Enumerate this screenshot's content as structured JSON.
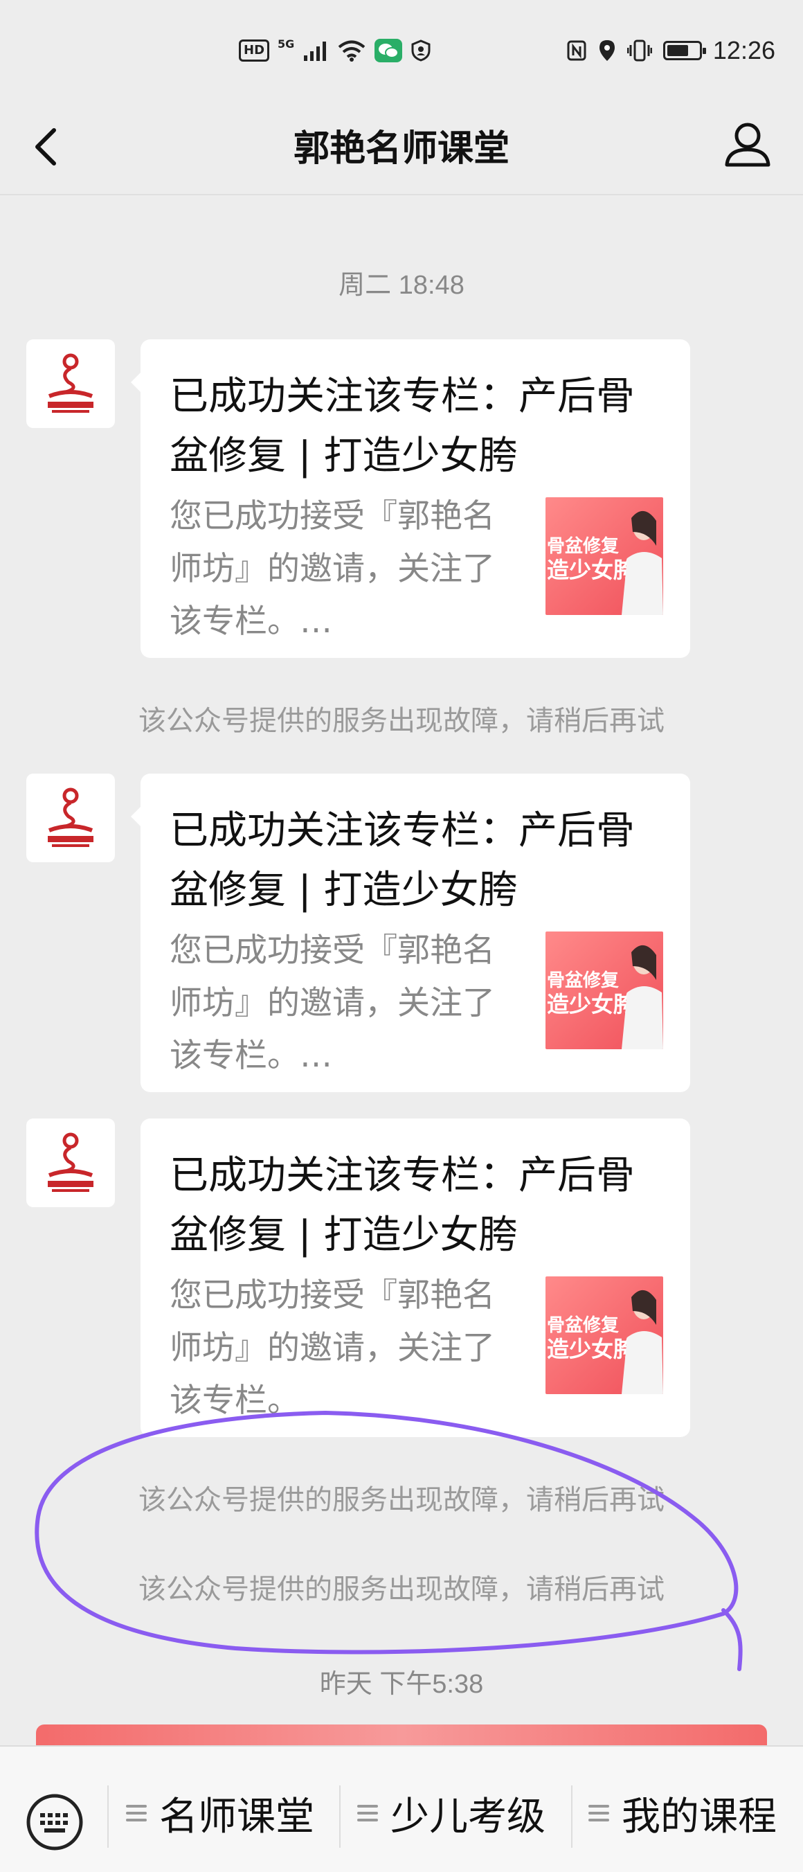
{
  "status_bar": {
    "hd_badge": "HD",
    "network": "5G",
    "time": "12:26"
  },
  "nav": {
    "title": "郭艳名师课堂"
  },
  "messages": {
    "timestamp_1": "周二 18:48",
    "card_1": {
      "title": "已成功关注该专栏：产后骨盆修复 | 打造少女胯",
      "desc": "您已成功接受『郭艳名师坊』的邀请，关注了该专栏。…",
      "thumb_line1": "骨盆修复",
      "thumb_line2": "造少女胯"
    },
    "system_1": "该公众号提供的服务出现故障，请稍后再试",
    "card_2": {
      "title": "已成功关注该专栏：产后骨盆修复 | 打造少女胯",
      "desc": "您已成功接受『郭艳名师坊』的邀请，关注了该专栏。…",
      "thumb_line1": "骨盆修复",
      "thumb_line2": "造少女胯"
    },
    "card_3": {
      "title": "已成功关注该专栏：产后骨盆修复 | 打造少女胯",
      "desc": "您已成功接受『郭艳名师坊』的邀请，关注了该专栏。",
      "thumb_line1": "骨盆修复",
      "thumb_line2": "造少女胯"
    },
    "system_2": "该公众号提供的服务出现故障，请稍后再试",
    "system_3": "该公众号提供的服务出现故障，请稍后再试",
    "timestamp_2": "昨天 下午5:38"
  },
  "menu": {
    "item_1": "名师课堂",
    "item_2": "少儿考级",
    "item_3": "我的课程"
  },
  "colors": {
    "annotation": "#8a5cf0",
    "thumb_pink": "#f0505a"
  }
}
